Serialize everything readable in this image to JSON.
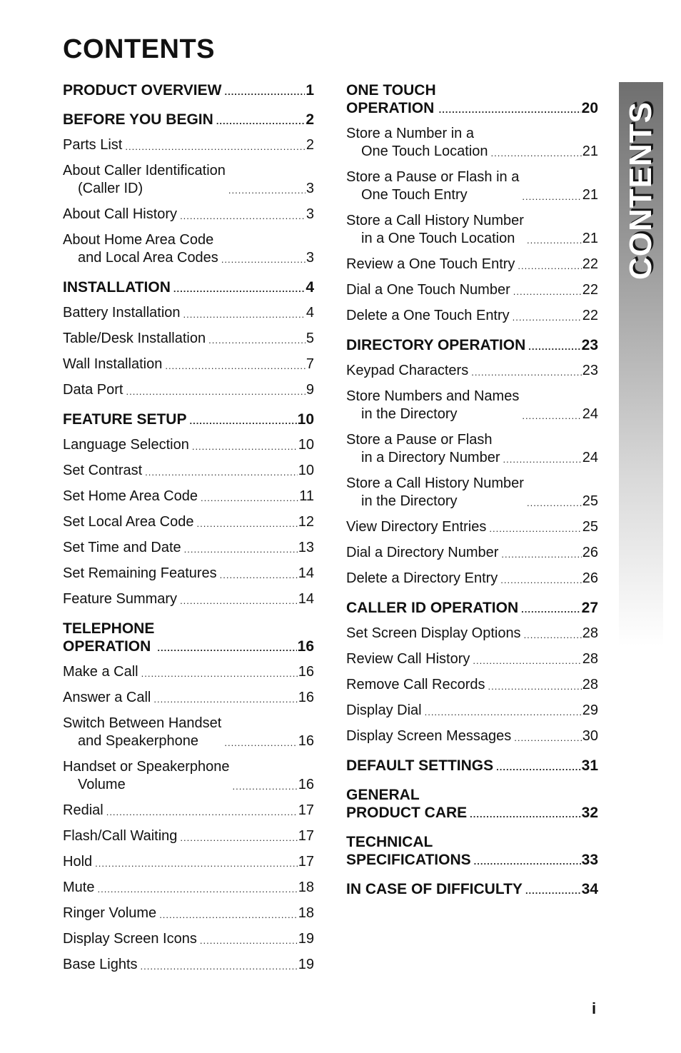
{
  "page_title": "CONTENTS",
  "side_tab_label": "CONTENTS",
  "page_number": "i",
  "left_column": [
    {
      "heading": "PRODUCT OVERVIEW",
      "page": "1",
      "items": []
    },
    {
      "heading": "BEFORE YOU BEGIN",
      "page": "2",
      "items": [
        {
          "line1": "Parts List",
          "line2": "",
          "page": "2"
        },
        {
          "line1": "About Caller Identification",
          "line2": "(Caller ID)",
          "page": "3"
        },
        {
          "line1": "About Call History",
          "line2": "",
          "page": "3"
        },
        {
          "line1": "About Home Area Code",
          "line2": "and Local Area Codes",
          "page": "3"
        }
      ]
    },
    {
      "heading": "INSTALLATION",
      "page": "4",
      "items": [
        {
          "line1": "Battery Installation",
          "line2": "",
          "page": "4"
        },
        {
          "line1": "Table/Desk Installation",
          "line2": "",
          "page": "5"
        },
        {
          "line1": "Wall Installation",
          "line2": "",
          "page": "7"
        },
        {
          "line1": "Data Port",
          "line2": "",
          "page": "9"
        }
      ]
    },
    {
      "heading": "FEATURE SETUP",
      "page": "10",
      "items": [
        {
          "line1": "Language Selection",
          "line2": "",
          "page": "10"
        },
        {
          "line1": "Set Contrast",
          "line2": "",
          "page": "10"
        },
        {
          "line1": "Set Home Area Code",
          "line2": "",
          "page": "11"
        },
        {
          "line1": "Set Local Area Code",
          "line2": "",
          "page": "12"
        },
        {
          "line1": "Set Time and Date",
          "line2": "",
          "page": "13"
        },
        {
          "line1": "Set Remaining Features",
          "line2": "",
          "page": "14"
        },
        {
          "line1": "Feature Summary",
          "line2": "",
          "page": "14"
        }
      ]
    },
    {
      "heading": "TELEPHONE\nOPERATION",
      "page": "16",
      "items": [
        {
          "line1": "Make a Call",
          "line2": "",
          "page": "16"
        },
        {
          "line1": "Answer a Call",
          "line2": "",
          "page": "16"
        },
        {
          "line1": "Switch Between Handset",
          "line2": "and Speakerphone",
          "page": "16"
        },
        {
          "line1": "Handset or Speakerphone",
          "line2": "Volume",
          "page": "16"
        },
        {
          "line1": "Redial",
          "line2": "",
          "page": "17"
        },
        {
          "line1": "Flash/Call Waiting",
          "line2": "",
          "page": "17"
        },
        {
          "line1": "Hold",
          "line2": "",
          "page": "17"
        },
        {
          "line1": "Mute",
          "line2": "",
          "page": "18"
        },
        {
          "line1": "Ringer Volume",
          "line2": "",
          "page": "18"
        },
        {
          "line1": "Display Screen Icons",
          "line2": "",
          "page": "19"
        },
        {
          "line1": "Base Lights",
          "line2": "",
          "page": "19"
        }
      ]
    }
  ],
  "right_column": [
    {
      "heading": "ONE TOUCH\nOPERATION",
      "page": "20",
      "items": [
        {
          "line1": "Store a Number in a",
          "line2": "One Touch Location",
          "page": "21"
        },
        {
          "line1": "Store a Pause or Flash in a",
          "line2": "One Touch Entry",
          "page": "21"
        },
        {
          "line1": "Store a Call History Number",
          "line2": "in a One Touch Location",
          "page": "21"
        },
        {
          "line1": "Review a One Touch Entry",
          "line2": "",
          "page": "22"
        },
        {
          "line1": "Dial a One Touch Number",
          "line2": "",
          "page": "22"
        },
        {
          "line1": "Delete a One Touch Entry",
          "line2": "",
          "page": "22"
        }
      ]
    },
    {
      "heading": "DIRECTORY OPERATION",
      "page": "23",
      "items": [
        {
          "line1": "Keypad Characters",
          "line2": "",
          "page": "23"
        },
        {
          "line1": "Store Numbers and Names",
          "line2": "in the Directory",
          "page": "24"
        },
        {
          "line1": "Store a Pause or Flash",
          "line2": "in a Directory Number",
          "page": "24"
        },
        {
          "line1": "Store a Call History Number",
          "line2": "in the Directory",
          "page": "25"
        },
        {
          "line1": "View Directory Entries",
          "line2": "",
          "page": "25"
        },
        {
          "line1": "Dial a Directory Number",
          "line2": "",
          "page": "26"
        },
        {
          "line1": "Delete a Directory Entry",
          "line2": "",
          "page": "26"
        }
      ]
    },
    {
      "heading": "CALLER ID OPERATION",
      "page": "27",
      "items": [
        {
          "line1": "Set Screen Display Options",
          "line2": "",
          "page": "28"
        },
        {
          "line1": "Review Call History",
          "line2": "",
          "page": "28"
        },
        {
          "line1": "Remove Call Records",
          "line2": "",
          "page": "28"
        },
        {
          "line1": "Display Dial",
          "line2": "",
          "page": "29"
        },
        {
          "line1": "Display Screen Messages",
          "line2": "",
          "page": "30"
        }
      ]
    },
    {
      "heading": "DEFAULT SETTINGS",
      "page": "31",
      "items": []
    },
    {
      "heading": "GENERAL\nPRODUCT CARE",
      "page": "32",
      "items": []
    },
    {
      "heading": "TECHNICAL\nSPECIFICATIONS",
      "page": "33",
      "items": []
    },
    {
      "heading": "IN CASE OF DIFFICULTY",
      "page": "34",
      "items": []
    }
  ]
}
